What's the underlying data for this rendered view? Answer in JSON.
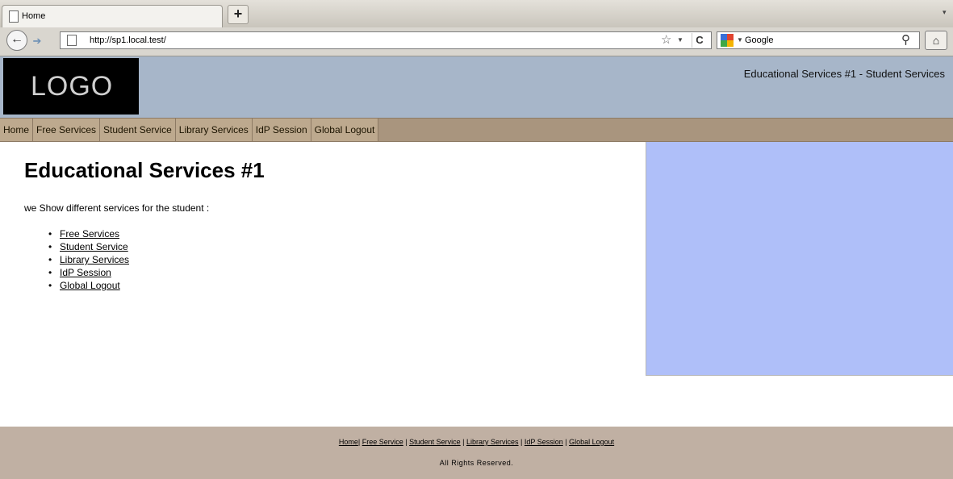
{
  "browser": {
    "tab_title": "Home",
    "new_tab_label": "+",
    "url": "http://sp1.local.test/",
    "search_engine": "Google"
  },
  "header": {
    "logo_text": "LOGO",
    "site_title": "Educational Services #1 - Student Services"
  },
  "nav": {
    "items": [
      {
        "label": "Home"
      },
      {
        "label": "Free Services"
      },
      {
        "label": "Student Service"
      },
      {
        "label": "Library Services"
      },
      {
        "label": "IdP Session"
      },
      {
        "label": "Global Logout"
      }
    ]
  },
  "main": {
    "heading": "Educational Services #1",
    "intro": "we Show different services for the student :",
    "services": [
      {
        "label": "Free Services"
      },
      {
        "label": "Student Service"
      },
      {
        "label": "Library Services"
      },
      {
        "label": "IdP Session"
      },
      {
        "label": "Global Logout"
      }
    ]
  },
  "footer": {
    "links": [
      {
        "label": "Home"
      },
      {
        "label": "Free Service"
      },
      {
        "label": "Student Service"
      },
      {
        "label": "Library Services"
      },
      {
        "label": "IdP Session"
      },
      {
        "label": "Global Logout"
      }
    ],
    "separator_first": "|",
    "separator": " | ",
    "copyright": "All Rights Reserved."
  },
  "colors": {
    "header_bg": "#a7b6c9",
    "nav_bg": "#bda98e",
    "sidebar_bg": "#afbff9",
    "footer_bg": "#c0b0a3",
    "logo_bg": "#000000"
  },
  "icons": {
    "back": "back-arrow-icon",
    "forward": "forward-arrow-icon",
    "page": "page-icon",
    "bookmark": "star-icon",
    "reload": "reload-icon",
    "search_engine": "google-icon",
    "search": "magnifier-icon",
    "home": "home-icon"
  }
}
